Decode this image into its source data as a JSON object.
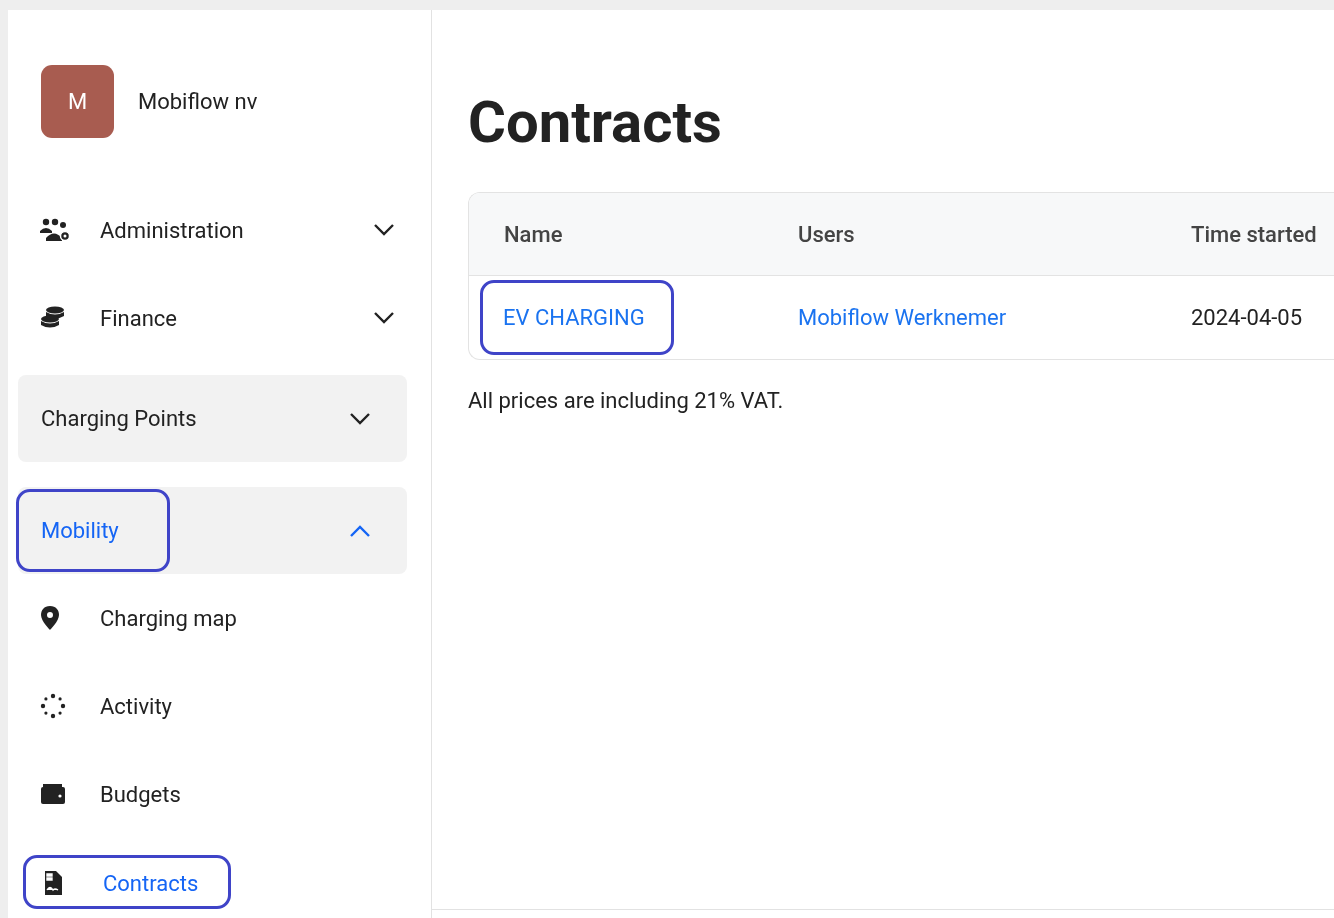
{
  "sidebar": {
    "org": {
      "initial": "M",
      "name": "Mobiflow nv"
    },
    "items": [
      {
        "kind": "menu",
        "label": "Administration",
        "expanded": false,
        "highlighted": false
      },
      {
        "kind": "menu",
        "label": "Finance",
        "expanded": false,
        "highlighted": false
      },
      {
        "kind": "group",
        "label": "Charging Points",
        "expanded": false,
        "highlighted": false
      },
      {
        "kind": "group",
        "label": "Mobility",
        "expanded": true,
        "highlighted": true,
        "children": [
          {
            "label": "Charging map",
            "selected": false,
            "highlighted": false
          },
          {
            "label": "Activity",
            "selected": false,
            "highlighted": false
          },
          {
            "label": "Budgets",
            "selected": false,
            "highlighted": false
          },
          {
            "label": "Contracts",
            "selected": true,
            "highlighted": true
          }
        ]
      }
    ]
  },
  "page": {
    "title": "Contracts"
  },
  "table": {
    "columns": [
      "Name",
      "Users",
      "Time started"
    ],
    "rows": [
      {
        "cells": [
          {
            "kind": "link",
            "text": "EV CHARGING",
            "highlighted": true
          },
          {
            "kind": "link",
            "text": "Mobiflow Werknemer",
            "highlighted": false
          },
          {
            "kind": "text",
            "text": "2024-04-05",
            "highlighted": false
          }
        ]
      }
    ]
  },
  "note": "All prices are including 21% VAT."
}
